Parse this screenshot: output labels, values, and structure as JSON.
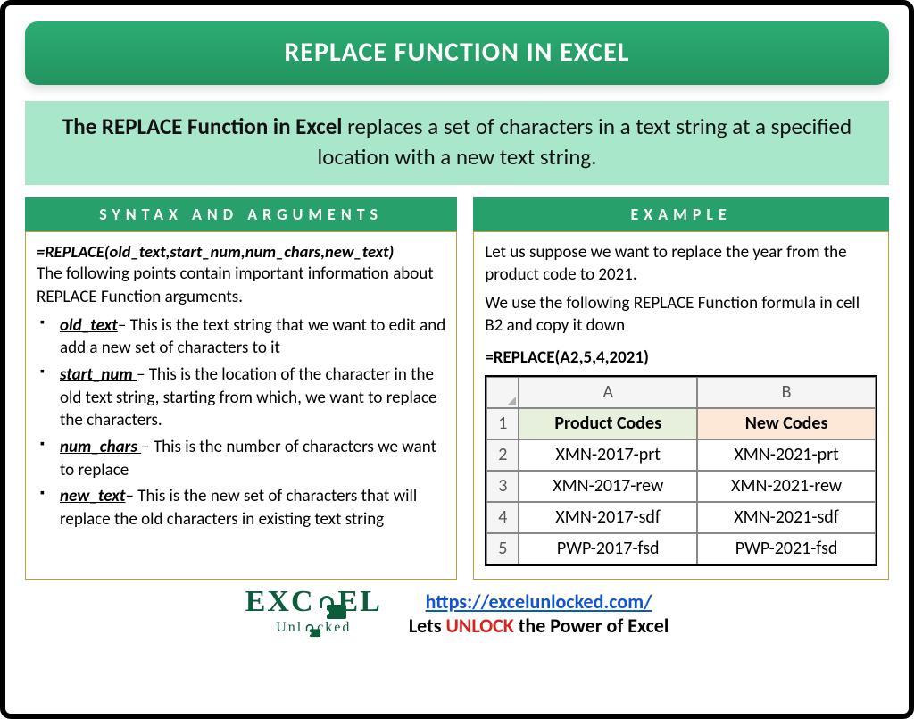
{
  "title": "REPLACE FUNCTION IN EXCEL",
  "summary_bold": "The REPLACE Function in Excel",
  "summary_rest": " replaces a set of characters in a text string at a specified location with a new text string.",
  "left": {
    "header": "SYNTAX AND ARGUMENTS",
    "syntax": "=REPLACE(old_text,start_num,num_chars,new_text)",
    "intro": "The following points contain important information about REPLACE Function arguments.",
    "args": [
      {
        "name": "old_text",
        "desc": "– This is the text string that we want to edit and add a new set of characters to it"
      },
      {
        "name": "start_num ",
        "desc": "– This is the location of the character in the old text string, starting from which, we want to replace the characters."
      },
      {
        "name": "num_chars ",
        "desc": "– This is the number of characters we want to replace"
      },
      {
        "name": "new_text",
        "desc": "– This is the new set of characters that will replace the old characters in existing text string"
      }
    ]
  },
  "right": {
    "header": "EXAMPLE",
    "p1": "Let us suppose we want to replace the year from the product code to 2021.",
    "p2": "We use the following REPLACE Function formula in cell B2 and copy it down",
    "formula": "=REPLACE(A2,5,4,2021)",
    "table": {
      "colA": "A",
      "colB": "B",
      "headerA": "Product Codes",
      "headerB": "New Codes",
      "rows": [
        {
          "n": "2",
          "a": "XMN-2017-prt",
          "b": "XMN-2021-prt"
        },
        {
          "n": "3",
          "a": "XMN-2017-rew",
          "b": "XMN-2021-rew"
        },
        {
          "n": "4",
          "a": "XMN-2017-sdf",
          "b": "XMN-2021-sdf"
        },
        {
          "n": "5",
          "a": "PWP-2017-fsd",
          "b": "PWP-2021-fsd"
        }
      ]
    }
  },
  "footer": {
    "logo_top": "EXC   EL",
    "logo_sub": "Unl   cked",
    "url": "https://excelunlocked.com/",
    "tag_pre": "Lets ",
    "tag_unlock": "UNLOCK",
    "tag_post": " the Power of Excel"
  }
}
